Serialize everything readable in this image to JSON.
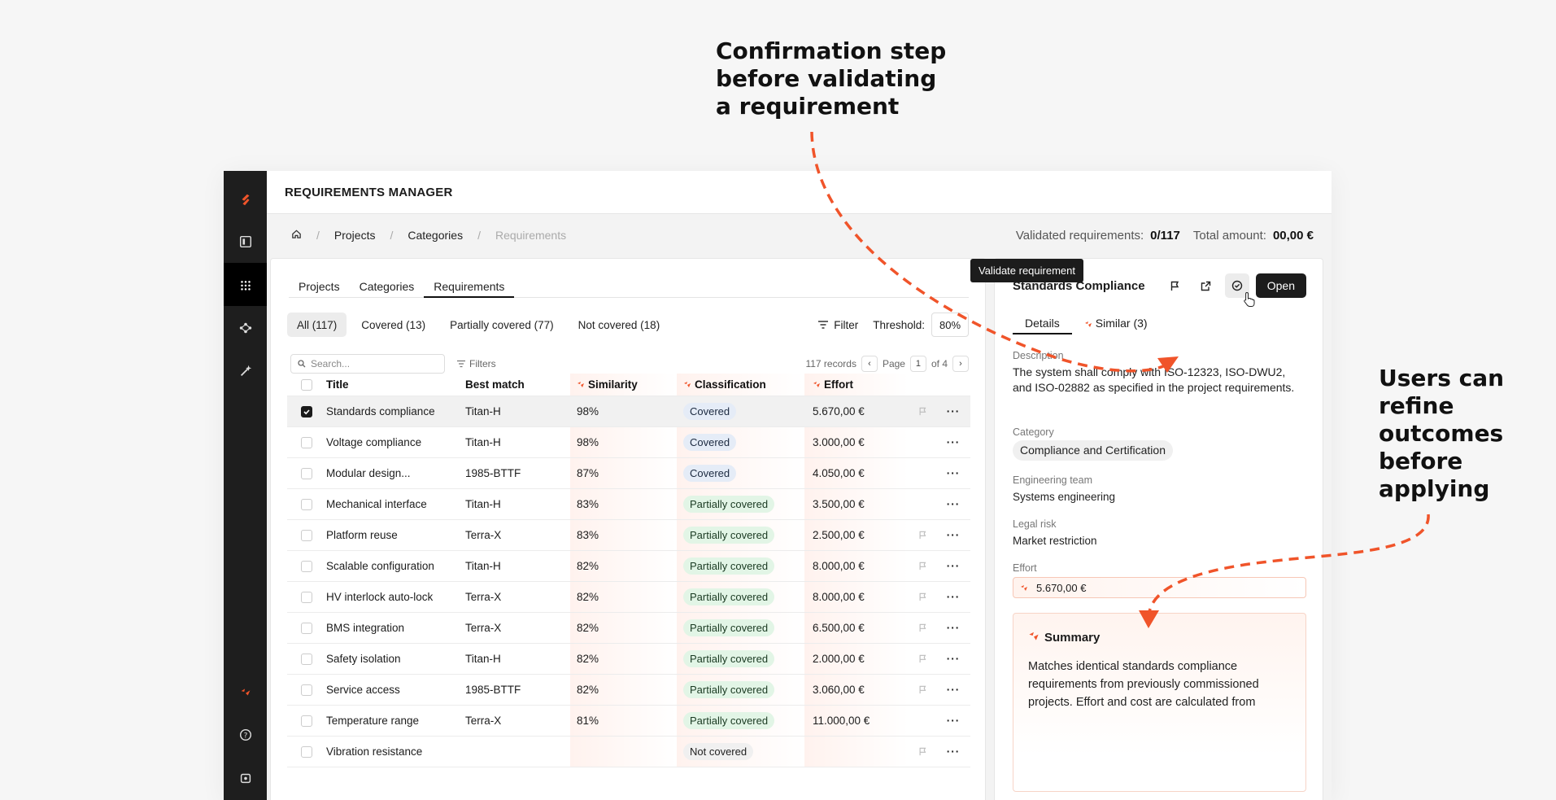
{
  "annotations": {
    "confirm": "Confirmation step\nbefore validating\na requirement",
    "refine": "Users can\nrefine\noutcomes\nbefore\napplying"
  },
  "colors": {
    "accent": "#f0542a",
    "dark": "#1c1c1c"
  },
  "rail": {
    "icons": [
      "logo-icon",
      "panel-toggle-icon",
      "apps-grid-icon",
      "network-icon",
      "magic-wand-icon",
      "spark-icon",
      "help-icon",
      "settings-icon"
    ]
  },
  "topbar": {
    "title": "REQUIREMENTS MANAGER"
  },
  "breadcrumb": {
    "items": [
      "Projects",
      "Categories",
      "Requirements"
    ]
  },
  "stats": {
    "validated_label": "Validated requirements:",
    "validated_value": "0/117",
    "total_label": "Total amount:",
    "total_value": "00,00 €"
  },
  "main": {
    "tabs": [
      "Projects",
      "Categories",
      "Requirements"
    ],
    "filters": [
      "All (117)",
      "Covered (13)",
      "Partially covered (77)",
      "Not covered (18)"
    ],
    "filter_label": "Filter",
    "threshold_label": "Threshold:",
    "threshold_value": "80%",
    "search_placeholder": "Search...",
    "filters_label": "Filters",
    "records": "117 records",
    "page_label": "Page",
    "page_current": "1",
    "page_total": "of 4",
    "columns": [
      "Title",
      "Best match",
      "Similarity",
      "Classification",
      "Effort"
    ],
    "rows": [
      {
        "title": "Standards compliance",
        "match": "Titan-H",
        "sim": "98%",
        "cls": "Covered",
        "eff": "5.670,00 €",
        "flag": true,
        "checked": true
      },
      {
        "title": "Voltage compliance",
        "match": "Titan-H",
        "sim": "98%",
        "cls": "Covered",
        "eff": "3.000,00 €",
        "flag": false,
        "checked": false
      },
      {
        "title": "Modular design...",
        "match": "1985-BTTF",
        "sim": "87%",
        "cls": "Covered",
        "eff": "4.050,00 €",
        "flag": false,
        "checked": false
      },
      {
        "title": "Mechanical interface",
        "match": "Titan-H",
        "sim": "83%",
        "cls": "Partially covered",
        "eff": "3.500,00 €",
        "flag": false,
        "checked": false
      },
      {
        "title": "Platform reuse",
        "match": "Terra-X",
        "sim": "83%",
        "cls": "Partially covered",
        "eff": "2.500,00 €",
        "flag": true,
        "checked": false
      },
      {
        "title": "Scalable configuration",
        "match": "Titan-H",
        "sim": "82%",
        "cls": "Partially covered",
        "eff": "8.000,00 €",
        "flag": true,
        "checked": false
      },
      {
        "title": "HV interlock auto-lock",
        "match": "Terra-X",
        "sim": "82%",
        "cls": "Partially covered",
        "eff": "8.000,00 €",
        "flag": true,
        "checked": false
      },
      {
        "title": "BMS integration",
        "match": "Terra-X",
        "sim": "82%",
        "cls": "Partially covered",
        "eff": "6.500,00 €",
        "flag": true,
        "checked": false
      },
      {
        "title": "Safety isolation",
        "match": "Titan-H",
        "sim": "82%",
        "cls": "Partially covered",
        "eff": "2.000,00 €",
        "flag": true,
        "checked": false
      },
      {
        "title": "Service access",
        "match": "1985-BTTF",
        "sim": "82%",
        "cls": "Partially covered",
        "eff": "3.060,00 €",
        "flag": true,
        "checked": false
      },
      {
        "title": "Temperature range",
        "match": "Terra-X",
        "sim": "81%",
        "cls": "Partially covered",
        "eff": "11.000,00 €",
        "flag": false,
        "checked": false
      },
      {
        "title": "Vibration resistance",
        "match": "",
        "sim": "",
        "cls": "Not covered",
        "eff": "",
        "flag": true,
        "checked": false
      }
    ]
  },
  "detail": {
    "title": "Standards Compliance",
    "open_label": "Open",
    "tooltip": "Validate requirement",
    "tabs": [
      "Details",
      "Similar (3)"
    ],
    "description_label": "Description",
    "description": "The system shall comply with ISO-12323, ISO-DWU2, and ISO-02882 as specified in the project requirements.",
    "category_label": "Category",
    "category": "Compliance and Certification",
    "team_label": "Engineering team",
    "team": "Systems engineering",
    "risk_label": "Legal risk",
    "risk": "Market restriction",
    "effort_label": "Effort",
    "effort": "5.670,00 €",
    "summary_title": "Summary",
    "summary": "Matches identical standards compliance requirements from previously commissioned projects. Effort and cost are calculated from"
  }
}
